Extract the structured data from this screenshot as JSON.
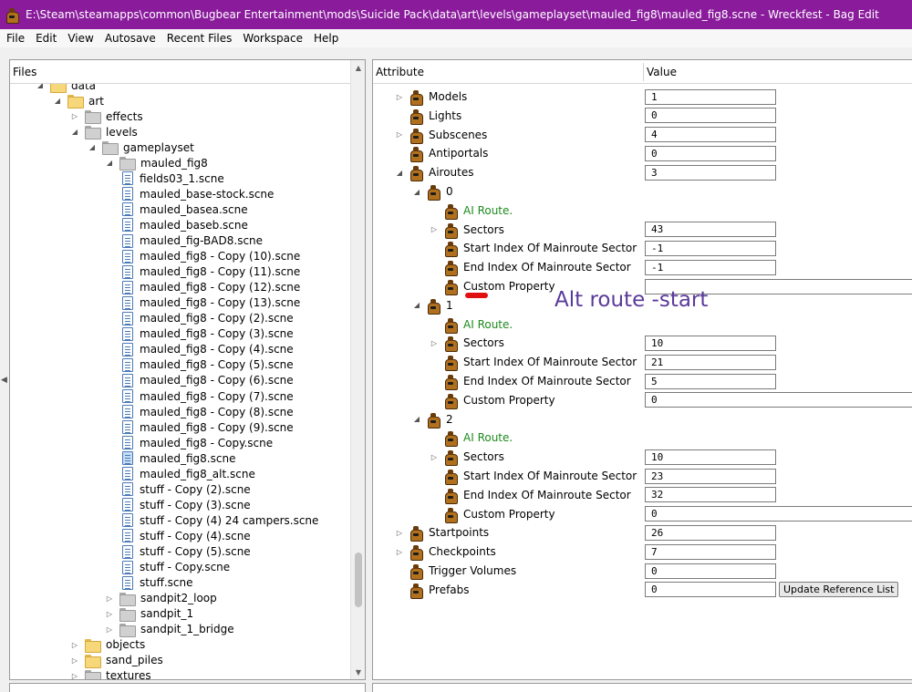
{
  "window": {
    "title": "E:\\Steam\\steamapps\\common\\Bugbear Entertainment\\mods\\Suicide Pack\\data\\art\\levels\\gameplayset\\mauled_fig8\\mauled_fig8.scne - Wreckfest - Bag Edit",
    "icon": "bag-icon"
  },
  "menu": [
    "File",
    "Edit",
    "View",
    "Autosave",
    "Recent Files",
    "Workspace",
    "Help"
  ],
  "files_panel": {
    "header": "Files",
    "tree": [
      {
        "label": "data",
        "type": "folder-yellow",
        "depth": 3,
        "arrow": "down"
      },
      {
        "label": "art",
        "type": "folder-yellow",
        "depth": 4,
        "arrow": "down"
      },
      {
        "label": "effects",
        "type": "folder-gray",
        "depth": 5,
        "arrow": "right"
      },
      {
        "label": "levels",
        "type": "folder-gray",
        "depth": 5,
        "arrow": "down"
      },
      {
        "label": "gameplayset",
        "type": "folder-gray",
        "depth": 6,
        "arrow": "down"
      },
      {
        "label": "mauled_fig8",
        "type": "folder-gray",
        "depth": 7,
        "arrow": "down"
      },
      {
        "label": "fields03_1.scne",
        "type": "file",
        "depth": 8
      },
      {
        "label": "mauled_base-stock.scne",
        "type": "file",
        "depth": 8
      },
      {
        "label": "mauled_basea.scne",
        "type": "file",
        "depth": 8
      },
      {
        "label": "mauled_baseb.scne",
        "type": "file",
        "depth": 8
      },
      {
        "label": "mauled_fig-BAD8.scne",
        "type": "file",
        "depth": 8
      },
      {
        "label": "mauled_fig8 - Copy (10).scne",
        "type": "file",
        "depth": 8
      },
      {
        "label": "mauled_fig8 - Copy (11).scne",
        "type": "file",
        "depth": 8
      },
      {
        "label": "mauled_fig8 - Copy (12).scne",
        "type": "file",
        "depth": 8
      },
      {
        "label": "mauled_fig8 - Copy (13).scne",
        "type": "file",
        "depth": 8
      },
      {
        "label": "mauled_fig8 - Copy (2).scne",
        "type": "file",
        "depth": 8
      },
      {
        "label": "mauled_fig8 - Copy (3).scne",
        "type": "file",
        "depth": 8
      },
      {
        "label": "mauled_fig8 - Copy (4).scne",
        "type": "file",
        "depth": 8
      },
      {
        "label": "mauled_fig8 - Copy (5).scne",
        "type": "file",
        "depth": 8
      },
      {
        "label": "mauled_fig8 - Copy (6).scne",
        "type": "file",
        "depth": 8
      },
      {
        "label": "mauled_fig8 - Copy (7).scne",
        "type": "file",
        "depth": 8
      },
      {
        "label": "mauled_fig8 - Copy (8).scne",
        "type": "file",
        "depth": 8
      },
      {
        "label": "mauled_fig8 - Copy (9).scne",
        "type": "file",
        "depth": 8
      },
      {
        "label": "mauled_fig8 - Copy.scne",
        "type": "file",
        "depth": 8
      },
      {
        "label": "mauled_fig8.scne",
        "type": "file",
        "depth": 8,
        "selected": true
      },
      {
        "label": "mauled_fig8_alt.scne",
        "type": "file",
        "depth": 8
      },
      {
        "label": "stuff - Copy (2).scne",
        "type": "file",
        "depth": 8
      },
      {
        "label": "stuff - Copy (3).scne",
        "type": "file",
        "depth": 8
      },
      {
        "label": "stuff - Copy (4) 24 campers.scne",
        "type": "file",
        "depth": 8
      },
      {
        "label": "stuff - Copy (4).scne",
        "type": "file",
        "depth": 8
      },
      {
        "label": "stuff - Copy (5).scne",
        "type": "file",
        "depth": 8
      },
      {
        "label": "stuff - Copy.scne",
        "type": "file",
        "depth": 8
      },
      {
        "label": "stuff.scne",
        "type": "file",
        "depth": 8
      },
      {
        "label": "sandpit2_loop",
        "type": "folder-gray",
        "depth": 7,
        "arrow": "right"
      },
      {
        "label": "sandpit_1",
        "type": "folder-gray",
        "depth": 7,
        "arrow": "right"
      },
      {
        "label": "sandpit_1_bridge",
        "type": "folder-gray",
        "depth": 7,
        "arrow": "right"
      },
      {
        "label": "objects",
        "type": "folder-yellow",
        "depth": 5,
        "arrow": "right"
      },
      {
        "label": "sand_piles",
        "type": "folder-yellow",
        "depth": 5,
        "arrow": "right"
      },
      {
        "label": "textures",
        "type": "folder-gray",
        "depth": 5,
        "arrow": "right"
      }
    ]
  },
  "attributes_panel": {
    "col_attribute": "Attribute",
    "col_value": "Value",
    "rows": [
      {
        "label": "Models",
        "depth": 1,
        "arrow": "right",
        "value": "1",
        "input": "short"
      },
      {
        "label": "Lights",
        "depth": 1,
        "value": "0",
        "input": "short"
      },
      {
        "label": "Subscenes",
        "depth": 1,
        "arrow": "right",
        "value": "4",
        "input": "short"
      },
      {
        "label": "Antiportals",
        "depth": 1,
        "value": "0",
        "input": "short"
      },
      {
        "label": "Airoutes",
        "depth": 1,
        "arrow": "down",
        "value": "3",
        "input": "short"
      },
      {
        "label": "0",
        "depth": 2,
        "arrow": "down"
      },
      {
        "label": "AI Route.",
        "depth": 3,
        "green": true
      },
      {
        "label": "Sectors",
        "depth": 3,
        "arrow": "right",
        "value": "43",
        "input": "short"
      },
      {
        "label": "Start Index Of Mainroute Sector",
        "depth": 3,
        "value": "-1",
        "input": "short"
      },
      {
        "label": "End Index Of Mainroute Sector",
        "depth": 3,
        "value": "-1",
        "input": "short"
      },
      {
        "label": "Custom Property",
        "depth": 3,
        "value": "",
        "input": "long"
      },
      {
        "label": "1",
        "depth": 2,
        "arrow": "down"
      },
      {
        "label": "AI Route.",
        "depth": 3,
        "green": true
      },
      {
        "label": "Sectors",
        "depth": 3,
        "arrow": "right",
        "value": "10",
        "input": "short"
      },
      {
        "label": "Start Index Of Mainroute Sector",
        "depth": 3,
        "value": "21",
        "input": "short"
      },
      {
        "label": "End Index Of Mainroute Sector",
        "depth": 3,
        "value": "5",
        "input": "short"
      },
      {
        "label": "Custom Property",
        "depth": 3,
        "value": "0",
        "input": "long"
      },
      {
        "label": "2",
        "depth": 2,
        "arrow": "down"
      },
      {
        "label": "AI Route.",
        "depth": 3,
        "green": true
      },
      {
        "label": "Sectors",
        "depth": 3,
        "arrow": "right",
        "value": "10",
        "input": "short"
      },
      {
        "label": "Start Index Of Mainroute Sector",
        "depth": 3,
        "value": "23",
        "input": "short"
      },
      {
        "label": "End Index Of Mainroute Sector",
        "depth": 3,
        "value": "32",
        "input": "short"
      },
      {
        "label": "Custom Property",
        "depth": 3,
        "value": "0",
        "input": "long"
      },
      {
        "label": "Startpoints",
        "depth": 1,
        "arrow": "right",
        "value": "26",
        "input": "short"
      },
      {
        "label": "Checkpoints",
        "depth": 1,
        "arrow": "right",
        "value": "7",
        "input": "short"
      },
      {
        "label": "Trigger Volumes",
        "depth": 1,
        "value": "0",
        "input": "short"
      },
      {
        "label": "Prefabs",
        "depth": 1,
        "value": "0",
        "input": "short",
        "button": "Update Reference List"
      }
    ]
  },
  "annotation": {
    "text": "Alt route -start",
    "color": "#5a3a9a",
    "mark_color": "#e01010"
  },
  "colors": {
    "titlebar": "#8a1c9c",
    "ai_route_green": "#1d8a1d"
  }
}
